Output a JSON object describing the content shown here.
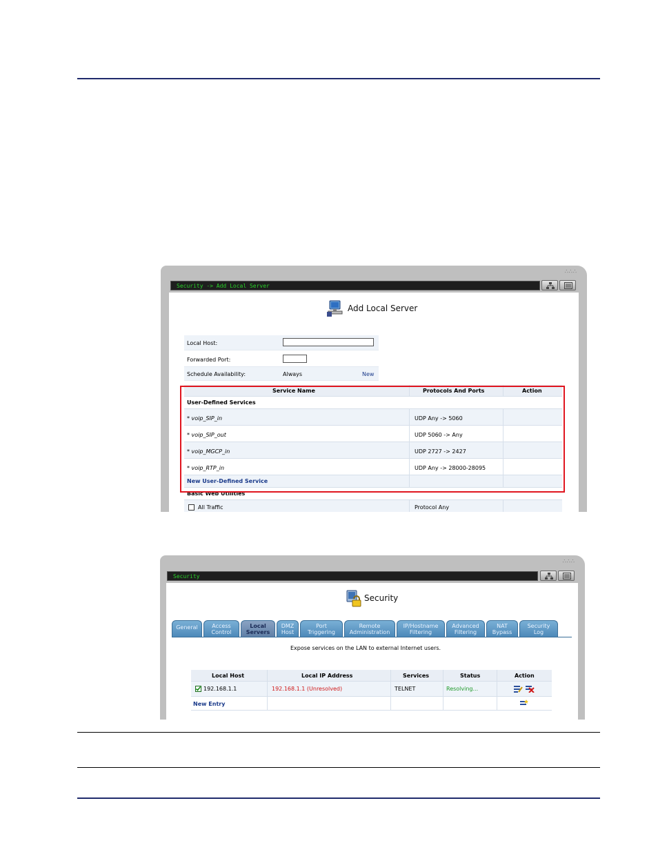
{
  "window1": {
    "breadcrumb": "Security -> Add Local Server",
    "title": "Add Local Server",
    "icon": "computer-server-icon",
    "form": {
      "local_host_label": "Local Host:",
      "local_host_value": "",
      "forwarded_port_label": "Forwarded Port:",
      "forwarded_port_value": "",
      "schedule_label": "Schedule Availability:",
      "schedule_value": "Always",
      "schedule_link": "New"
    },
    "services_table": {
      "headers": [
        "Service Name",
        "Protocols And Ports",
        "Action"
      ],
      "group_user": "User-Defined Services",
      "rows": [
        {
          "name": "* voip_SIP_in",
          "proto": "UDP  Any -> 5060"
        },
        {
          "name": "* voip_SIP_out",
          "proto": "UDP  5060 -> Any"
        },
        {
          "name": "* voip_MGCP_in",
          "proto": "UDP  2727 -> 2427"
        },
        {
          "name": "* voip_RTP_in",
          "proto": "UDP  Any -> 28000-28095"
        }
      ],
      "new_service": "New User-Defined Service",
      "group_basic": "Basic Web Utilities",
      "partial_row_name": "All Traffic",
      "partial_row_proto": "Protocol  Any"
    }
  },
  "window2": {
    "breadcrumb": "Security",
    "title": "Security",
    "icon": "security-lock-icon",
    "tabs": [
      {
        "label": "General"
      },
      {
        "label": "Access\nControl"
      },
      {
        "label": "Local\nServers",
        "active": true
      },
      {
        "label": "DMZ\nHost"
      },
      {
        "label": "Port\nTriggering"
      },
      {
        "label": "Remote\nAdministration"
      },
      {
        "label": "IP/Hostname\nFiltering"
      },
      {
        "label": "Advanced\nFiltering"
      },
      {
        "label": "NAT\nBypass"
      },
      {
        "label": "Security\nLog"
      }
    ],
    "description": "Expose services on the LAN to external Internet users.",
    "table": {
      "headers": [
        "Local Host",
        "Local IP Address",
        "Services",
        "Status",
        "Action"
      ],
      "row": {
        "host": "192.168.1.1",
        "ip": "192.168.1.1 (Unresolved)",
        "services": "TELNET",
        "status": "Resolving..."
      },
      "new_entry": "New Entry"
    }
  },
  "colors": {
    "accent_red": "#e0141e",
    "link_blue": "#1a3a8a",
    "status_green": "#1f9a2a",
    "ip_red": "#d01818",
    "rule_navy": "#1f2a6b"
  }
}
